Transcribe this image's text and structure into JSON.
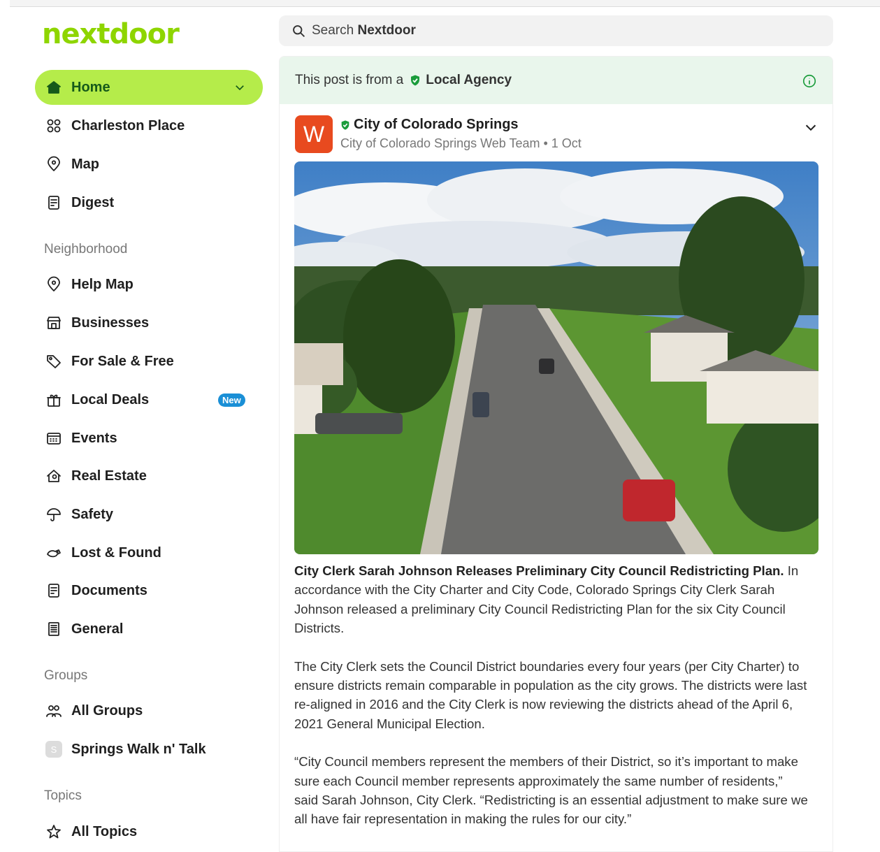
{
  "brand": {
    "logo_text": "nextdoor",
    "accent": "#8ed500",
    "active_bg": "#b5ec4a"
  },
  "search": {
    "prefix": "Search",
    "brand": "Nextdoor"
  },
  "sidebar": {
    "main": [
      {
        "label": "Home",
        "icon": "home-icon"
      },
      {
        "label": "Charleston Place",
        "icon": "neighborhood-icon"
      },
      {
        "label": "Map",
        "icon": "map-pin-icon"
      },
      {
        "label": "Digest",
        "icon": "digest-icon"
      }
    ],
    "neighborhood_heading": "Neighborhood",
    "neighborhood": [
      {
        "label": "Help Map",
        "icon": "map-pin-icon"
      },
      {
        "label": "Businesses",
        "icon": "storefront-icon"
      },
      {
        "label": "For Sale & Free",
        "icon": "price-tag-icon"
      },
      {
        "label": "Local Deals",
        "icon": "gift-icon",
        "badge": "New"
      },
      {
        "label": "Events",
        "icon": "calendar-icon"
      },
      {
        "label": "Real Estate",
        "icon": "house-icon"
      },
      {
        "label": "Safety",
        "icon": "umbrella-icon"
      },
      {
        "label": "Lost & Found",
        "icon": "pet-icon"
      },
      {
        "label": "Documents",
        "icon": "document-icon"
      },
      {
        "label": "General",
        "icon": "notepad-icon"
      }
    ],
    "groups_heading": "Groups",
    "groups": [
      {
        "label": "All Groups",
        "icon": "people-icon"
      },
      {
        "label": "Springs Walk n' Talk",
        "avatar": "S"
      }
    ],
    "topics_heading": "Topics",
    "topics": [
      {
        "label": "All Topics",
        "icon": "star-icon"
      }
    ]
  },
  "post": {
    "agency_prefix": "This post is from a",
    "agency_label": "Local Agency",
    "author_initial": "W",
    "author_name": "City of Colorado Springs",
    "author_meta": "City of Colorado Springs  Web Team • 1 Oct",
    "headline": "City Clerk Sarah Johnson Releases Preliminary City Council Redistricting Plan.",
    "para1": "In accordance with the City Charter and City Code, Colorado Springs City Clerk Sarah Johnson released a preliminary City Council Redistricting Plan for the six City Council Districts.",
    "para2": "The City Clerk sets the Council District boundaries every four years (per City Charter) to ensure districts remain comparable in population as the city grows. The districts were last re-aligned in 2016 and the City Clerk is now reviewing the districts ahead of the April 6, 2021 General Municipal Election.",
    "para3": "“City Council members represent the members of their District, so it’s important to make sure each Council member represents approximately the same number of residents,” said Sarah Johnson, City Clerk. “Redistricting is an essential adjustment to make sure we all have fair representation in making the rules for our city.”"
  }
}
